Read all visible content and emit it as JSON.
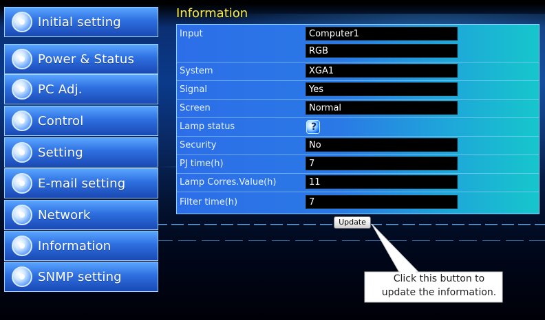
{
  "sidebar": {
    "items": [
      {
        "label": "Initial setting",
        "icon": "wrench-gear-icon"
      },
      {
        "label": "Power & Status",
        "icon": "projector-icon"
      },
      {
        "label": "PC Adj.",
        "icon": "monitor-icon"
      },
      {
        "label": "Control",
        "icon": "control-pad-icon"
      },
      {
        "label": "Setting",
        "icon": "tools-icon"
      },
      {
        "label": "E-mail setting",
        "icon": "envelope-icon"
      },
      {
        "label": "Network",
        "icon": "network-icon"
      },
      {
        "label": "Information",
        "icon": "info-icon"
      },
      {
        "label": "SNMP setting",
        "icon": "snmp-icon"
      }
    ]
  },
  "main": {
    "title": "Information",
    "rows": [
      {
        "label": "Input",
        "value": "Computer1"
      },
      {
        "label": "",
        "value": "RGB"
      },
      {
        "label": "System",
        "value": "XGA1"
      },
      {
        "label": "Signal",
        "value": "Yes"
      },
      {
        "label": "Screen",
        "value": "Normal"
      },
      {
        "label": "Lamp status",
        "value": "",
        "icon": "lamp-status-icon"
      },
      {
        "label": "Security",
        "value": "No"
      },
      {
        "label": "PJ time(h)",
        "value": "7"
      },
      {
        "label": "Lamp Corres.Value(h)",
        "value": "11"
      },
      {
        "label": "Filter time(h)",
        "value": "7"
      }
    ],
    "update_label": "Update"
  },
  "callout": {
    "text_line1": "Click this button to",
    "text_line2": "update the information."
  },
  "colors": {
    "title": "#ffeb3b",
    "sidebar_button": "#2e6fe0",
    "value_box": "#000000",
    "table_left": "#2c6ee8",
    "table_right": "#16c6cc"
  }
}
